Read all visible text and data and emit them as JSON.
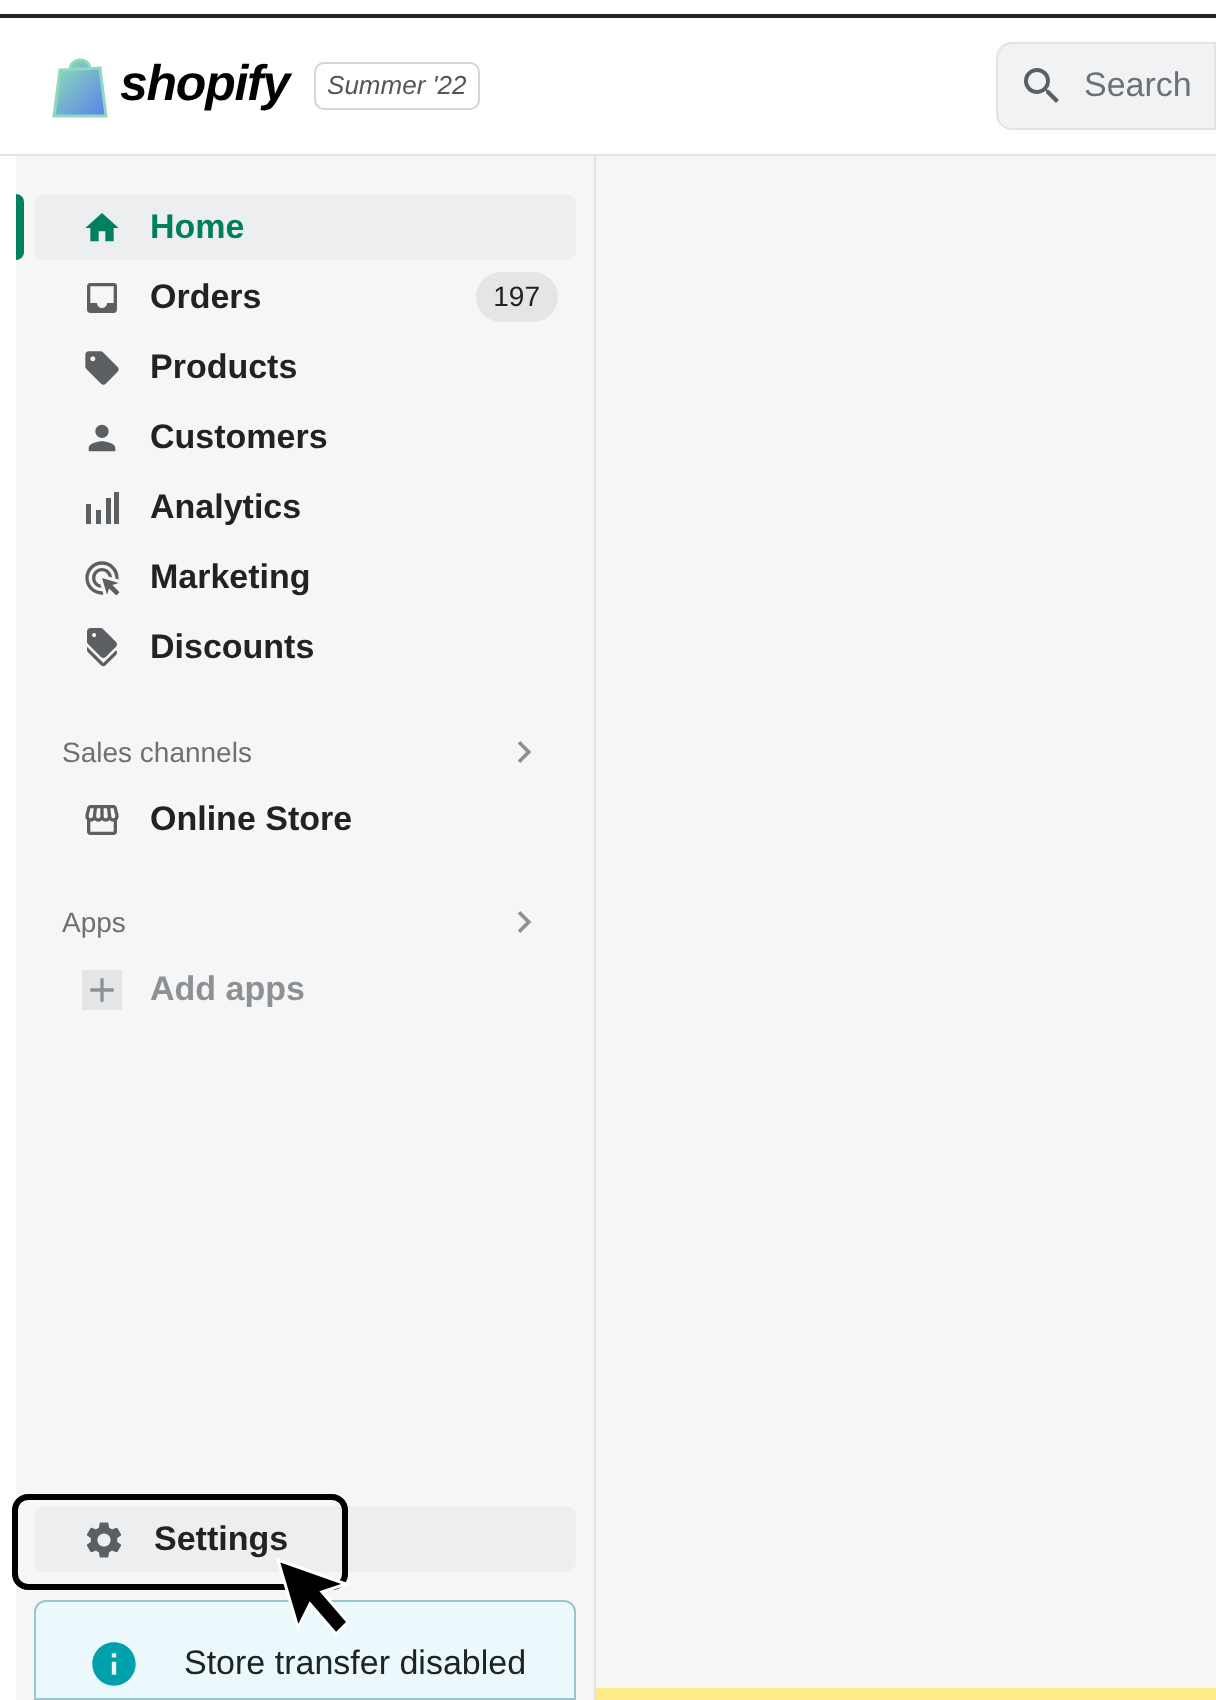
{
  "header": {
    "brand": "shopify",
    "edition": "Summer '22",
    "search": {
      "placeholder": "Search"
    }
  },
  "sidebar": {
    "items": [
      {
        "label": "Home",
        "selected": true
      },
      {
        "label": "Orders",
        "selected": false,
        "badge": "197"
      },
      {
        "label": "Products",
        "selected": false
      },
      {
        "label": "Customers",
        "selected": false
      },
      {
        "label": "Analytics",
        "selected": false
      },
      {
        "label": "Marketing",
        "selected": false
      },
      {
        "label": "Discounts",
        "selected": false
      }
    ],
    "sections": [
      {
        "title": "Sales channels",
        "items": [
          {
            "label": "Online Store",
            "kind": "link"
          }
        ]
      },
      {
        "title": "Apps",
        "items": [
          {
            "label": "Add apps",
            "kind": "add"
          }
        ]
      }
    ],
    "settings": {
      "label": "Settings",
      "hovered": true
    },
    "notice": {
      "text": "Store transfer disabled"
    }
  }
}
